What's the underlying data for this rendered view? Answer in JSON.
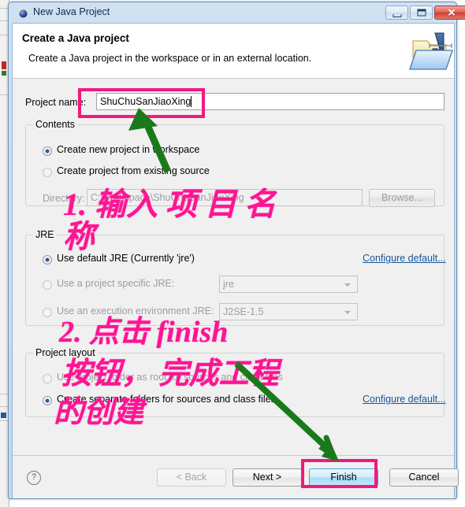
{
  "window": {
    "title": "New Java Project",
    "icon": "java-project-icon",
    "controls": {
      "minimize": "minimize-button",
      "maximize": "maximize-button",
      "close_glyph": "✕"
    }
  },
  "header": {
    "title": "Create a Java project",
    "description": "Create a Java project in the workspace or in an external location.",
    "icon": "new-java-project-folder-icon"
  },
  "form": {
    "project_name_label": "Project name:",
    "project_name_value": "ShuChuSanJiaoXing"
  },
  "contents": {
    "group_title": "Contents",
    "option_new_workspace": "Create new project in workspace",
    "option_existing_source": "Create project from existing source",
    "directory_label": "Directory:",
    "directory_value": "C:\\workspace\\ShuChuSanJiaoXing",
    "browse_label": "Browse..."
  },
  "jre": {
    "group_title": "JRE",
    "option_default": "Use default JRE (Currently 'jre')",
    "option_specific": "Use a project specific JRE:",
    "option_specific_value": "jre",
    "option_environment": "Use an execution environment JRE:",
    "option_environment_value": "J2SE-1.5",
    "configure_default_link": "Configure default..."
  },
  "project_layout": {
    "group_title": "Project layout",
    "option_root": "Use project folder as root for sources and class files",
    "option_separate": "Create separate folders for sources and class files",
    "configure_default_link": "Configure default..."
  },
  "footer": {
    "help_glyph": "?",
    "back_label": "< Back",
    "next_label": "Next >",
    "finish_label": "Finish",
    "cancel_label": "Cancel"
  },
  "annotations": {
    "step1_line1": "1.  输入 项 目 名",
    "step1_line2": "称",
    "step2_line1": "2.  点击 finish",
    "step2_line2": "按钮， 完成工程",
    "step2_line3": "的创建",
    "highlight_color": "#f0197f",
    "text_color": "#ff1493",
    "arrow_color": "#1a7a1a"
  }
}
